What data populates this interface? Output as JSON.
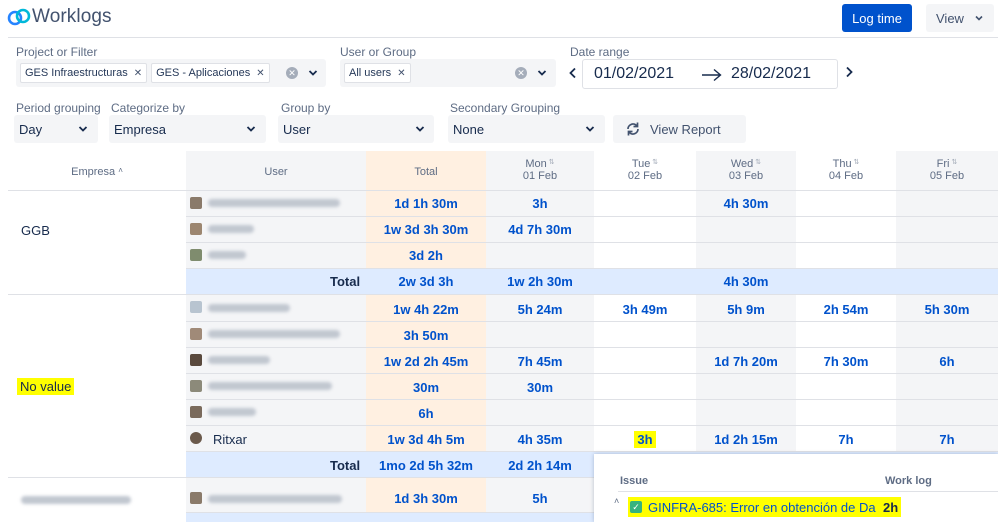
{
  "header": {
    "app_title": "Worklogs",
    "log_time_label": "Log time",
    "view_label": "View"
  },
  "filters": {
    "project_label": "Project or Filter",
    "project_tags": [
      "GES Infraestructuras",
      "GES - Aplicaciones"
    ],
    "user_label": "User or Group",
    "user_tags": [
      "All users"
    ],
    "date_range_label": "Date range",
    "date_from": "01/02/2021",
    "date_to": "28/02/2021",
    "period_grouping_label": "Period grouping",
    "period_grouping_value": "Day",
    "categorize_by_label": "Categorize by",
    "categorize_by_value": "Empresa",
    "group_by_label": "Group by",
    "group_by_value": "User",
    "secondary_grouping_label": "Secondary Grouping",
    "secondary_grouping_value": "None",
    "view_report_label": "View Report"
  },
  "table": {
    "col_empresa": "Empresa",
    "col_user": "User",
    "col_total": "Total",
    "days": [
      {
        "dow": "Mon",
        "date": "01 Feb"
      },
      {
        "dow": "Tue",
        "date": "02 Feb"
      },
      {
        "dow": "Wed",
        "date": "03 Feb"
      },
      {
        "dow": "Thu",
        "date": "04 Feb"
      },
      {
        "dow": "Fri",
        "date": "05 Feb"
      }
    ],
    "total_label": "Total",
    "groups": [
      {
        "name": "GGB",
        "rows": [
          {
            "total": "1d 1h 30m",
            "days": [
              "3h",
              "",
              "4h 30m",
              "",
              ""
            ]
          },
          {
            "total": "1w 3d 3h 30m",
            "days": [
              "4d 7h 30m",
              "",
              "",
              "",
              ""
            ]
          },
          {
            "total": "3d 2h",
            "days": [
              "",
              "",
              "",
              "",
              ""
            ]
          }
        ],
        "subtotal": {
          "total": "2w 3d 3h",
          "days": [
            "1w 2h 30m",
            "",
            "4h 30m",
            "",
            ""
          ]
        }
      },
      {
        "name": "No value",
        "rows": [
          {
            "total": "1w 4h 22m",
            "days": [
              "5h 24m",
              "3h 49m",
              "5h 9m",
              "2h 54m",
              "5h 30m"
            ]
          },
          {
            "total": "3h 50m",
            "days": [
              "",
              "",
              "",
              "",
              ""
            ]
          },
          {
            "total": "1w 2d 2h 45m",
            "days": [
              "7h 45m",
              "",
              "1d 7h 20m",
              "7h 30m",
              "6h"
            ]
          },
          {
            "total": "30m",
            "days": [
              "30m",
              "",
              "",
              "",
              ""
            ]
          },
          {
            "total": "6h",
            "days": [
              "",
              "",
              "",
              "",
              ""
            ]
          },
          {
            "user": "Ritxar",
            "total": "1w 3d 4h 5m",
            "days": [
              "4h 35m",
              "3h",
              "1d 2h 15m",
              "7h",
              "7h"
            ]
          }
        ],
        "subtotal": {
          "total": "1mo 2d 5h 32m",
          "days": [
            "2d 2h 14m",
            "",
            "",
            "",
            ""
          ]
        }
      },
      {
        "name": "",
        "rows": [
          {
            "total": "1d 3h 30m",
            "days": [
              "5h",
              "",
              "",
              "",
              ""
            ]
          }
        ]
      }
    ]
  },
  "popup": {
    "col_issue": "Issue",
    "col_worklog": "Work log",
    "issue_text": "GINFRA-685: Error en obtención de Da",
    "worklog_value": "2h"
  },
  "colors": {
    "primary": "#0052cc",
    "total_col_bg": "#fff0e1",
    "subtotal_bg": "#deebff",
    "weekend_bg": "#f4f5f7",
    "highlight": "#ffff00"
  }
}
